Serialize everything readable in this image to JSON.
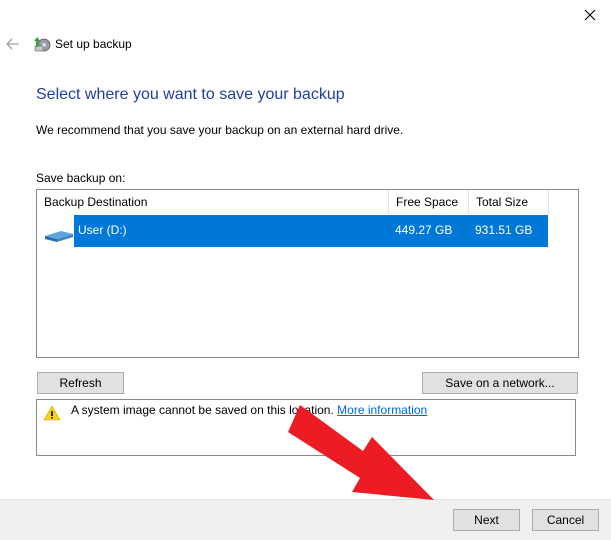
{
  "window": {
    "title": "Set up backup",
    "close_icon": "close-icon",
    "back_icon": "back-arrow-icon",
    "app_icon": "backup-icon"
  },
  "main": {
    "heading": "Select where you want to save your backup",
    "recommendation": "We recommend that you save your backup on an external hard drive.",
    "save_label": "Save backup on:",
    "list": {
      "columns": [
        "Backup Destination",
        "Free Space",
        "Total Size"
      ],
      "rows": [
        {
          "icon": "drive-icon",
          "destination": "User (D:)",
          "free_space": "449.27 GB",
          "total_size": "931.51 GB",
          "selected": true
        }
      ]
    },
    "refresh_label": "Refresh",
    "network_label": "Save on a network...",
    "info": {
      "icon": "warning-icon",
      "message": "A system image cannot be saved on this location.",
      "link": "More information"
    }
  },
  "footer": {
    "next_label": "Next",
    "cancel_label": "Cancel"
  },
  "colors": {
    "heading": "#1e3f9c",
    "selection": "#0078d7",
    "link": "#0066cc",
    "annotation_arrow": "#ed1c24"
  }
}
